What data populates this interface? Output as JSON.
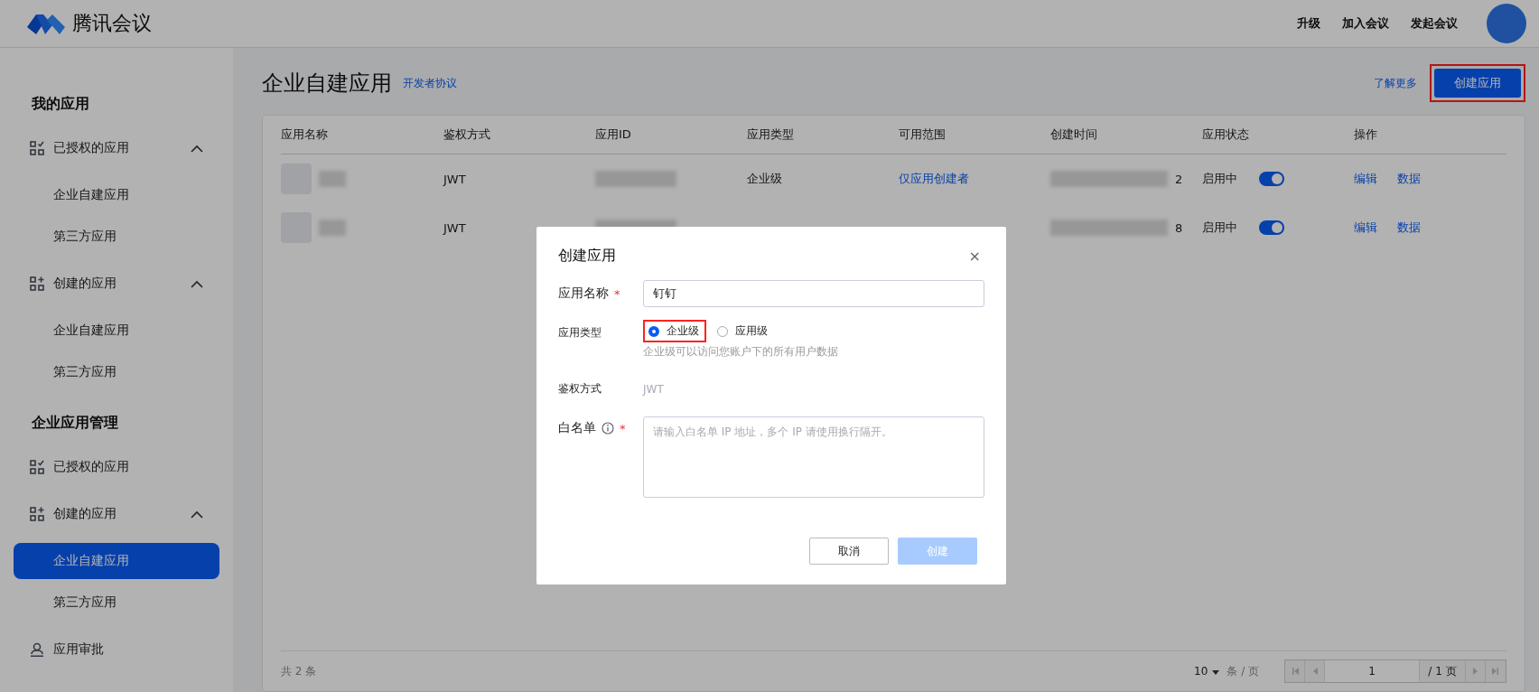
{
  "header": {
    "logo_text": "腾讯会议",
    "nav": [
      "升级",
      "加入会议",
      "发起会议"
    ]
  },
  "sidebar": {
    "sections": [
      {
        "title": "我的应用",
        "items": [
          {
            "label": "已授权的应用",
            "kind": "grid-check",
            "expanded": true,
            "children": [
              {
                "label": "企业自建应用",
                "selected": false
              },
              {
                "label": "第三方应用",
                "selected": false
              }
            ]
          },
          {
            "label": "创建的应用",
            "kind": "grid-plus",
            "expanded": true,
            "children": [
              {
                "label": "企业自建应用",
                "selected": false
              },
              {
                "label": "第三方应用",
                "selected": false
              }
            ]
          }
        ]
      },
      {
        "title": "企业应用管理",
        "items": [
          {
            "label": "已授权的应用",
            "kind": "grid-check"
          },
          {
            "label": "创建的应用",
            "kind": "grid-plus",
            "expanded": true,
            "children": [
              {
                "label": "企业自建应用",
                "selected": true
              },
              {
                "label": "第三方应用",
                "selected": false
              }
            ]
          },
          {
            "label": "应用审批",
            "kind": "person"
          }
        ]
      }
    ]
  },
  "page": {
    "title": "企业自建应用",
    "agreement_link": "开发者协议",
    "learn_more": "了解更多",
    "create_button": {
      "label": "创建应用",
      "highlighted": true
    }
  },
  "table": {
    "columns": [
      "应用名称",
      "鉴权方式",
      "应用ID",
      "应用类型",
      "可用范围",
      "创建时间",
      "应用状态",
      "操作"
    ],
    "rows": [
      {
        "auth": "JWT",
        "app_type": "企业级",
        "scope": "仅应用创建者",
        "time_tail": "2",
        "status": "启用中",
        "on": true,
        "actions": [
          "编辑",
          "数据"
        ]
      },
      {
        "auth": "JWT",
        "time_tail": "8",
        "status": "启用中",
        "on": true,
        "actions": [
          "编辑",
          "数据"
        ]
      }
    ]
  },
  "pagination": {
    "total": "共 2 条",
    "page_size": "10",
    "per_page": "条 / 页",
    "page": "1",
    "pages": "/ 1 页"
  },
  "dialog": {
    "title": "创建应用",
    "close": "×",
    "name": {
      "label": "应用名称",
      "required": "*",
      "value": "钉钉"
    },
    "type": {
      "label": "应用类型",
      "options": [
        {
          "label": "企业级",
          "selected": true,
          "highlighted": true
        },
        {
          "label": "应用级",
          "selected": false,
          "highlighted": false
        }
      ],
      "hint": "企业级可以访问您账户下的所有用户数据"
    },
    "auth": {
      "label": "鉴权方式",
      "value": "JWT"
    },
    "whitelist": {
      "label": "白名单",
      "required": "*",
      "placeholder": "请输入白名单 IP 地址，多个 IP 请使用换行隔开。"
    },
    "buttons": {
      "cancel": "取消",
      "confirm": "创建"
    }
  }
}
